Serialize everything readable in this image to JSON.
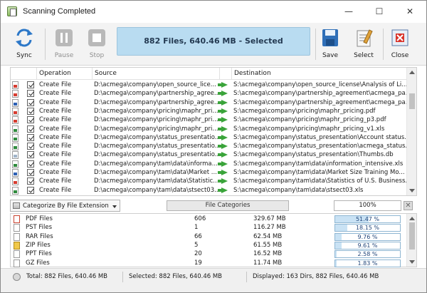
{
  "window": {
    "title": "Scanning Completed"
  },
  "toolbar": {
    "sync": "Sync",
    "pause": "Pause",
    "stop": "Stop",
    "status": "882 Files, 640.46 MB - Selected",
    "save": "Save",
    "select": "Select",
    "close": "Close"
  },
  "operations": {
    "headers": {
      "operation": "Operation",
      "source": "Source",
      "destination": "Destination"
    },
    "rows": [
      {
        "icon": "pdf",
        "op": "Create File",
        "src": "D:\\acmega\\company\\open_source_lice...",
        "dst": "S:\\acmega\\company\\open_source_license\\Analysis of Li..."
      },
      {
        "icon": "pdf",
        "op": "Create File",
        "src": "D:\\acmega\\company\\partnership_agree...",
        "dst": "S:\\acmega\\company\\partnership_agreement\\acmega_pa..."
      },
      {
        "icon": "doc",
        "op": "Create File",
        "src": "D:\\acmega\\company\\partnership_agree...",
        "dst": "S:\\acmega\\company\\partnership_agreement\\acmega_pa..."
      },
      {
        "icon": "pdf",
        "op": "Create File",
        "src": "D:\\acmega\\company\\pricing\\maphr_pri...",
        "dst": "S:\\acmega\\company\\pricing\\maphr_pricing.pdf"
      },
      {
        "icon": "pdf",
        "op": "Create File",
        "src": "D:\\acmega\\company\\pricing\\maphr_pri...",
        "dst": "S:\\acmega\\company\\pricing\\maphr_pricing_p3.pdf"
      },
      {
        "icon": "xls",
        "op": "Create File",
        "src": "D:\\acmega\\company\\pricing\\maphr_pri...",
        "dst": "S:\\acmega\\company\\pricing\\maphr_pricing_v1.xls"
      },
      {
        "icon": "xls",
        "op": "Create File",
        "src": "D:\\acmega\\company\\status_presentatio...",
        "dst": "S:\\acmega\\company\\status_presentation\\Account status..."
      },
      {
        "icon": "xls",
        "op": "Create File",
        "src": "D:\\acmega\\company\\status_presentatio...",
        "dst": "S:\\acmega\\company\\status_presentation\\acmega_status..."
      },
      {
        "icon": "gen",
        "op": "Create File",
        "src": "D:\\acmega\\company\\status_presentatio...",
        "dst": "S:\\acmega\\company\\status_presentation\\Thumbs.db"
      },
      {
        "icon": "xls",
        "op": "Create File",
        "src": "D:\\acmega\\company\\tam\\data\\informa...",
        "dst": "S:\\acmega\\company\\tam\\data\\information_intensive.xls"
      },
      {
        "icon": "doc",
        "op": "Create File",
        "src": "D:\\acmega\\company\\tam\\data\\Market ...",
        "dst": "S:\\acmega\\company\\tam\\data\\Market Size Training Mo..."
      },
      {
        "icon": "pdf",
        "op": "Create File",
        "src": "D:\\acmega\\company\\tam\\data\\Statistic...",
        "dst": "S:\\acmega\\company\\tam\\data\\Statistics of U.S. Business..."
      },
      {
        "icon": "xls",
        "op": "Create File",
        "src": "D:\\acmega\\company\\tam\\data\\stsect03...",
        "dst": "S:\\acmega\\company\\tam\\data\\stsect03.xls"
      }
    ]
  },
  "categories": {
    "selector": "Categorize By File Extension",
    "button": "File Categories",
    "total_percent": "100%",
    "rows": [
      {
        "icon": "pdf",
        "name": "PDF Files",
        "count": "606",
        "size": "329.67 MB",
        "percent": "51.47 %",
        "fraction": 0.5147
      },
      {
        "icon": "gen",
        "name": "PST Files",
        "count": "1",
        "size": "116.27 MB",
        "percent": "18.15 %",
        "fraction": 0.1815
      },
      {
        "icon": "gen",
        "name": "RAR Files",
        "count": "66",
        "size": "62.54 MB",
        "percent": "9.76 %",
        "fraction": 0.0976
      },
      {
        "icon": "zip",
        "name": "ZIP Files",
        "count": "5",
        "size": "61.55 MB",
        "percent": "9.61 %",
        "fraction": 0.0961
      },
      {
        "icon": "gen",
        "name": "PPT Files",
        "count": "20",
        "size": "16.52 MB",
        "percent": "2.58 %",
        "fraction": 0.0258
      },
      {
        "icon": "gen",
        "name": "GZ Files",
        "count": "19",
        "size": "11.74 MB",
        "percent": "1.83 %",
        "fraction": 0.0183
      }
    ]
  },
  "statusbar": {
    "total": "Total: 882 Files, 640.46 MB",
    "selected": "Selected: 882 Files, 640.46 MB",
    "displayed": "Displayed: 163 Dirs, 882 Files, 640.46 MB"
  }
}
